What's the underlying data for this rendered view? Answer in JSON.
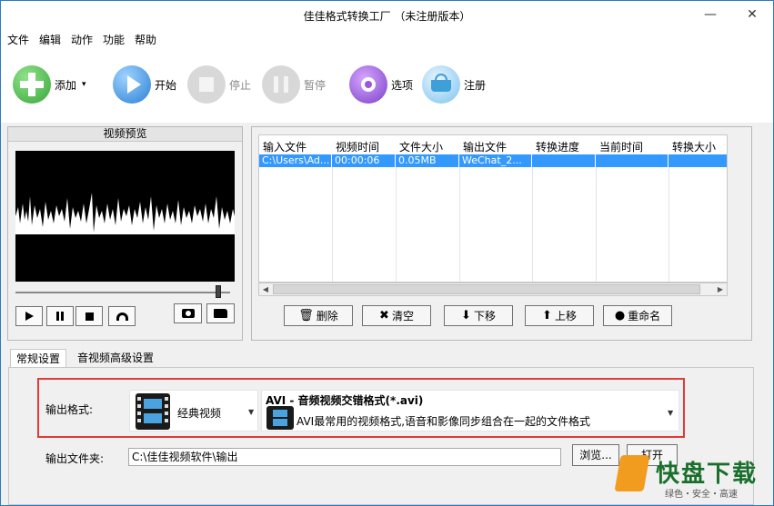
{
  "window": {
    "title": "佳佳格式转换工厂  （未注册版本）",
    "minimize": "—",
    "close": "✕"
  },
  "menu": [
    "文件",
    "编辑",
    "动作",
    "功能",
    "帮助"
  ],
  "toolbar": {
    "add": "添加",
    "add_arrow": "▾",
    "start": "开始",
    "stop": "停止",
    "pause": "暂停",
    "options": "选项",
    "register": "注册"
  },
  "preview": {
    "title": "视频预览"
  },
  "table": {
    "headers": [
      "输入文件",
      "视频时间",
      "文件大小",
      "输出文件",
      "转换进度",
      "当前时间",
      "转换大小"
    ],
    "rows": [
      [
        "C:\\Users\\Ad...",
        "00:00:06",
        "0.05MB",
        "WeChat_2...",
        "",
        "",
        ""
      ]
    ]
  },
  "actions": {
    "delete": "删除",
    "clear": "清空",
    "down": "下移",
    "up": "上移",
    "rename": "重命名"
  },
  "tabs": [
    "常规设置",
    "音视频高级设置"
  ],
  "settings": {
    "output_format_label": "输出格式:",
    "category": "经典视频",
    "format_title": "AVI - 音频视频交错格式(*.avi)",
    "format_desc": "AVI最常用的视频格式,语音和影像同步组合在一起的文件格式",
    "output_folder_label": "输出文件夹:",
    "output_folder": "C:\\佳佳视频软件\\输出",
    "browse": "浏览...",
    "open": "打开"
  },
  "watermark": {
    "brand": "快盘下载",
    "tagline": "绿色・安全・高速"
  },
  "colors": {
    "selection": "#3399ff",
    "highlight_border": "#e03a3a",
    "accent": "#2b79c2"
  }
}
